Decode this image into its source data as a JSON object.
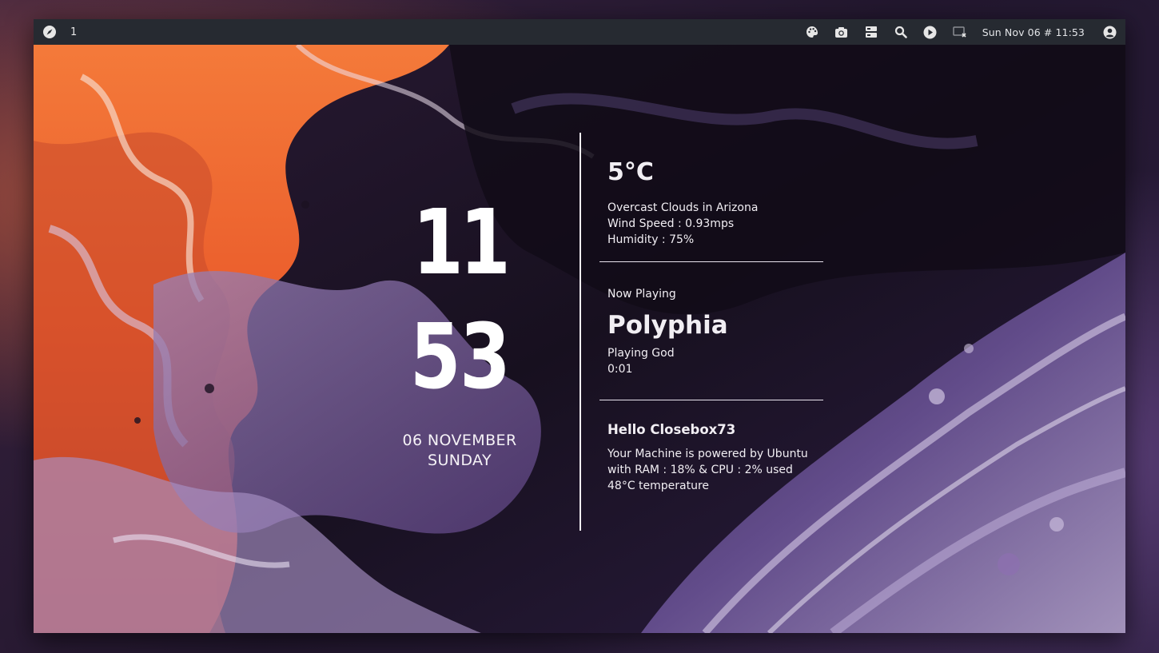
{
  "topbar": {
    "workspace": "1",
    "datetime": "Sun Nov 06 # 11:53",
    "icons": [
      "compass-icon",
      "palette-icon",
      "camera-icon",
      "layout-icon",
      "search-icon",
      "play-icon",
      "screen-close-icon",
      "user-icon"
    ]
  },
  "clock": {
    "hour": "11",
    "minute": "53",
    "date": "06 NOVEMBER",
    "day": "SUNDAY"
  },
  "weather": {
    "temp": "5°C",
    "desc": "Overcast Clouds in Arizona",
    "wind": "Wind Speed :  0.93mps",
    "humidity": "Humidity : 75%"
  },
  "music": {
    "label": "Now Playing",
    "artist": "Polyphia",
    "song": "Playing God",
    "time": "0:01"
  },
  "system": {
    "greeting": "Hello Closebox73",
    "line1": "Your Machine is powered by Ubuntu",
    "line2": "with RAM : 18% & CPU : 2% used",
    "line3": "48°C temperature"
  },
  "colors": {
    "bar_bg": "#262a31",
    "text": "#ffffff",
    "accent_orange": "#f26a2e",
    "accent_purple": "#7a5aa6"
  }
}
